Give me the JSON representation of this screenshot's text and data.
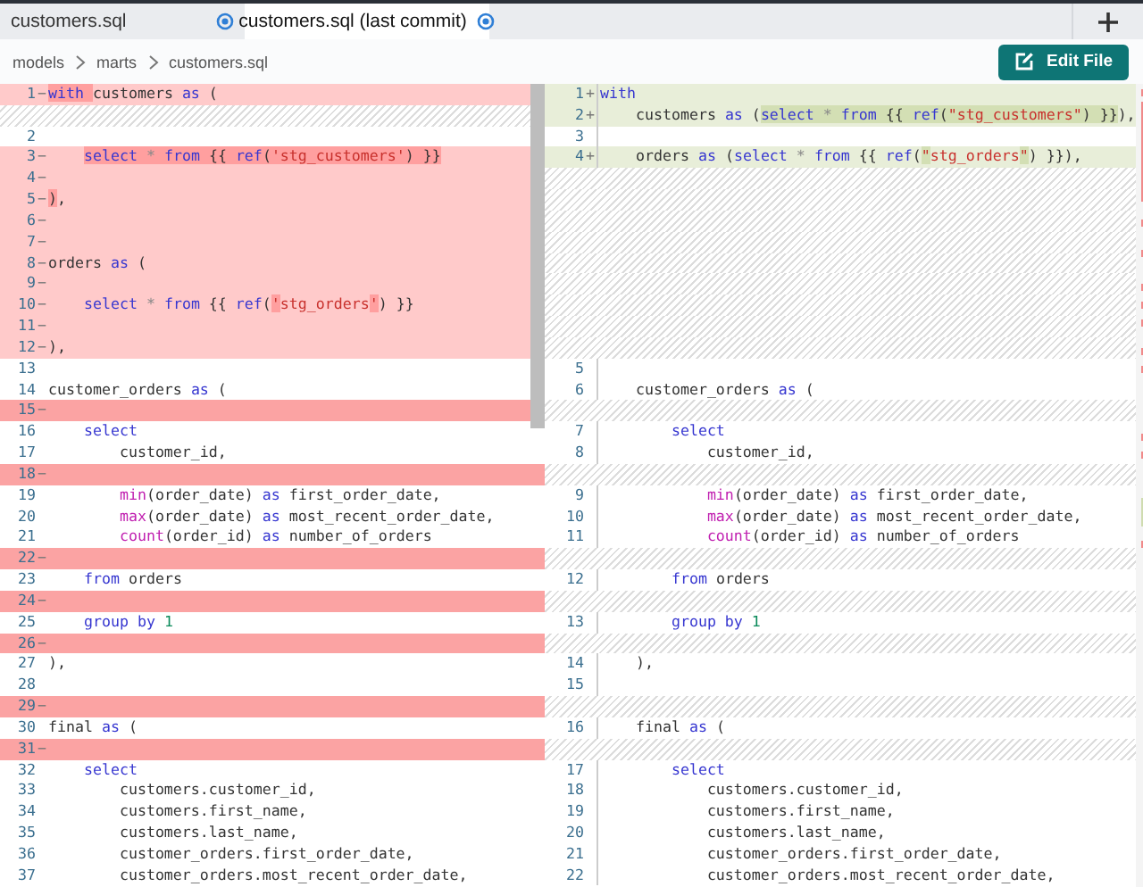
{
  "tabs": [
    {
      "label": "customers.sql",
      "selected": false
    },
    {
      "label": "customers.sql (last commit)",
      "selected": true
    }
  ],
  "breadcrumb": [
    "models",
    "marts",
    "customers.sql"
  ],
  "edit_button": "Edit File",
  "left_lines": [
    {
      "kind": "removed",
      "strong": false,
      "number": "1",
      "sign": "−",
      "code": [
        {
          "kind": "kw",
          "text": "with ",
          "highlighted": true
        },
        {
          "kind": "txt",
          "text": "customers ",
          "highlighted": false
        },
        {
          "kind": "kw",
          "text": "as",
          "highlighted": false
        },
        {
          "kind": "txt",
          "text": " (",
          "highlighted": false
        }
      ]
    },
    {
      "kind": "filler"
    },
    {
      "kind": "context",
      "number": "2"
    },
    {
      "kind": "removed",
      "strong": false,
      "number": "3",
      "sign": "−",
      "code": [
        {
          "kind": "kw",
          "text": "    select",
          "highlighted": true
        },
        {
          "kind": "op",
          "text": " * ",
          "highlighted": true
        },
        {
          "kind": "kw",
          "text": "from",
          "highlighted": true
        },
        {
          "kind": "txt",
          "text": " {{ ",
          "highlighted": true
        },
        {
          "kind": "kw",
          "text": "ref",
          "highlighted": true
        },
        {
          "kind": "txt",
          "text": "(",
          "highlighted": true
        },
        {
          "kind": "str",
          "text": "'stg_customers'",
          "highlighted": true
        },
        {
          "kind": "txt",
          "text": ") }}",
          "highlighted": true
        }
      ]
    },
    {
      "kind": "removed",
      "strong": false,
      "number": "4",
      "sign": "−"
    },
    {
      "kind": "removed",
      "strong": false,
      "number": "5",
      "sign": "−",
      "code": [
        {
          "kind": "txt",
          "text": ")",
          "highlighted": true
        },
        {
          "kind": "txt",
          "text": ",",
          "highlighted": false
        }
      ]
    },
    {
      "kind": "removed",
      "strong": false,
      "number": "6",
      "sign": "−"
    },
    {
      "kind": "removed",
      "strong": false,
      "number": "7",
      "sign": "−"
    },
    {
      "kind": "removed",
      "strong": false,
      "number": "8",
      "sign": "−",
      "code": [
        {
          "kind": "txt",
          "text": "orders ",
          "highlighted": false
        },
        {
          "kind": "kw",
          "text": "as",
          "highlighted": false
        },
        {
          "kind": "txt",
          "text": " (",
          "highlighted": false
        }
      ]
    },
    {
      "kind": "removed",
      "strong": false,
      "number": "9",
      "sign": "−"
    },
    {
      "kind": "removed",
      "strong": false,
      "number": "10",
      "sign": "−",
      "code": [
        {
          "kind": "kw",
          "text": "    select",
          "highlighted": false
        },
        {
          "kind": "op",
          "text": " * ",
          "highlighted": false
        },
        {
          "kind": "kw",
          "text": "from",
          "highlighted": false
        },
        {
          "kind": "txt",
          "text": " {{ ",
          "highlighted": false
        },
        {
          "kind": "kw",
          "text": "ref",
          "highlighted": false
        },
        {
          "kind": "txt",
          "text": "(",
          "highlighted": false
        },
        {
          "kind": "str",
          "text": "'",
          "highlighted": true
        },
        {
          "kind": "str",
          "text": "stg_orders",
          "highlighted": false
        },
        {
          "kind": "str",
          "text": "'",
          "highlighted": true
        },
        {
          "kind": "txt",
          "text": ") }}",
          "highlighted": false
        }
      ]
    },
    {
      "kind": "removed",
      "strong": false,
      "number": "11",
      "sign": "−"
    },
    {
      "kind": "removed",
      "strong": false,
      "number": "12",
      "sign": "−",
      "code": [
        {
          "kind": "txt",
          "text": "),",
          "highlighted": false
        }
      ]
    },
    {
      "kind": "context",
      "number": "13"
    },
    {
      "kind": "context",
      "number": "14",
      "code": [
        {
          "kind": "txt",
          "text": "customer_orders ",
          "highlighted": false
        },
        {
          "kind": "kw",
          "text": "as",
          "highlighted": false
        },
        {
          "kind": "txt",
          "text": " (",
          "highlighted": false
        }
      ]
    },
    {
      "kind": "removed",
      "strong": true,
      "number": "15",
      "sign": "−"
    },
    {
      "kind": "context",
      "number": "16",
      "code": [
        {
          "kind": "kw",
          "text": "    select",
          "highlighted": false
        }
      ]
    },
    {
      "kind": "context",
      "number": "17",
      "code": [
        {
          "kind": "txt",
          "text": "        customer_id,",
          "highlighted": false
        }
      ]
    },
    {
      "kind": "removed",
      "strong": true,
      "number": "18",
      "sign": "−"
    },
    {
      "kind": "context",
      "number": "19",
      "code": [
        {
          "kind": "fn",
          "text": "        min",
          "highlighted": false
        },
        {
          "kind": "txt",
          "text": "(order_date) ",
          "highlighted": false
        },
        {
          "kind": "kw",
          "text": "as",
          "highlighted": false
        },
        {
          "kind": "txt",
          "text": " first_order_date,",
          "highlighted": false
        }
      ]
    },
    {
      "kind": "context",
      "number": "20",
      "code": [
        {
          "kind": "fn",
          "text": "        max",
          "highlighted": false
        },
        {
          "kind": "txt",
          "text": "(order_date) ",
          "highlighted": false
        },
        {
          "kind": "kw",
          "text": "as",
          "highlighted": false
        },
        {
          "kind": "txt",
          "text": " most_recent_order_date,",
          "highlighted": false
        }
      ]
    },
    {
      "kind": "context",
      "number": "21",
      "code": [
        {
          "kind": "fn",
          "text": "        count",
          "highlighted": false
        },
        {
          "kind": "txt",
          "text": "(order_id) ",
          "highlighted": false
        },
        {
          "kind": "kw",
          "text": "as",
          "highlighted": false
        },
        {
          "kind": "txt",
          "text": " number_of_orders",
          "highlighted": false
        }
      ]
    },
    {
      "kind": "removed",
      "strong": true,
      "number": "22",
      "sign": "−"
    },
    {
      "kind": "context",
      "number": "23",
      "code": [
        {
          "kind": "kw",
          "text": "    from",
          "highlighted": false
        },
        {
          "kind": "txt",
          "text": " orders",
          "highlighted": false
        }
      ]
    },
    {
      "kind": "removed",
      "strong": true,
      "number": "24",
      "sign": "−"
    },
    {
      "kind": "context",
      "number": "25",
      "code": [
        {
          "kind": "kw",
          "text": "    group by",
          "highlighted": false
        },
        {
          "kind": "num",
          "text": " 1",
          "highlighted": false
        }
      ]
    },
    {
      "kind": "removed",
      "strong": true,
      "number": "26",
      "sign": "−"
    },
    {
      "kind": "context",
      "number": "27",
      "code": [
        {
          "kind": "txt",
          "text": "),",
          "highlighted": false
        }
      ]
    },
    {
      "kind": "context",
      "number": "28"
    },
    {
      "kind": "removed",
      "strong": true,
      "number": "29",
      "sign": "−"
    },
    {
      "kind": "context",
      "number": "30",
      "code": [
        {
          "kind": "txt",
          "text": "final ",
          "highlighted": false
        },
        {
          "kind": "kw",
          "text": "as",
          "highlighted": false
        },
        {
          "kind": "txt",
          "text": " (",
          "highlighted": false
        }
      ]
    },
    {
      "kind": "removed",
      "strong": true,
      "number": "31",
      "sign": "−"
    },
    {
      "kind": "context",
      "number": "32",
      "code": [
        {
          "kind": "kw",
          "text": "    select",
          "highlighted": false
        }
      ]
    },
    {
      "kind": "context",
      "number": "33",
      "code": [
        {
          "kind": "txt",
          "text": "        customers.customer_id,",
          "highlighted": false
        }
      ]
    },
    {
      "kind": "context",
      "number": "34",
      "code": [
        {
          "kind": "txt",
          "text": "        customers.first_name,",
          "highlighted": false
        }
      ]
    },
    {
      "kind": "context",
      "number": "35",
      "code": [
        {
          "kind": "txt",
          "text": "        customers.last_name,",
          "highlighted": false
        }
      ]
    },
    {
      "kind": "context",
      "number": "36",
      "code": [
        {
          "kind": "txt",
          "text": "        customer_orders.first_order_date,",
          "highlighted": false
        }
      ]
    },
    {
      "kind": "context",
      "number": "37",
      "code": [
        {
          "kind": "txt",
          "text": "        customer_orders.most_recent_order_date,",
          "highlighted": false
        }
      ]
    }
  ],
  "right_lines": [
    {
      "kind": "added",
      "number": "1",
      "sign": "+",
      "code": [
        {
          "kind": "kw",
          "text": "with",
          "highlighted": false
        }
      ]
    },
    {
      "kind": "added",
      "number": "2",
      "sign": "+",
      "code": [
        {
          "kind": "txt",
          "text": "    customers ",
          "highlighted": false
        },
        {
          "kind": "kw",
          "text": "as",
          "highlighted": false
        },
        {
          "kind": "txt",
          "text": " (",
          "highlighted": false
        },
        {
          "kind": "kw",
          "text": "select",
          "highlighted": true
        },
        {
          "kind": "op",
          "text": " * ",
          "highlighted": true
        },
        {
          "kind": "kw",
          "text": "from",
          "highlighted": true
        },
        {
          "kind": "txt",
          "text": " {{ ",
          "highlighted": true
        },
        {
          "kind": "kw",
          "text": "ref",
          "highlighted": true
        },
        {
          "kind": "txt",
          "text": "(",
          "highlighted": true
        },
        {
          "kind": "str",
          "text": "\"stg_customers\"",
          "highlighted": true
        },
        {
          "kind": "txt",
          "text": ") }}",
          "highlighted": true
        },
        {
          "kind": "txt",
          "text": "),",
          "highlighted": false
        }
      ]
    },
    {
      "kind": "context",
      "number": "3"
    },
    {
      "kind": "added",
      "number": "4",
      "sign": "+",
      "code": [
        {
          "kind": "txt",
          "text": "    orders ",
          "highlighted": false
        },
        {
          "kind": "kw",
          "text": "as",
          "highlighted": false
        },
        {
          "kind": "txt",
          "text": " (",
          "highlighted": false
        },
        {
          "kind": "kw",
          "text": "select",
          "highlighted": false
        },
        {
          "kind": "op",
          "text": " * ",
          "highlighted": false
        },
        {
          "kind": "kw",
          "text": "from",
          "highlighted": false
        },
        {
          "kind": "txt",
          "text": " {{ ",
          "highlighted": false
        },
        {
          "kind": "kw",
          "text": "ref",
          "highlighted": false
        },
        {
          "kind": "txt",
          "text": "(",
          "highlighted": false
        },
        {
          "kind": "str",
          "text": "\"",
          "highlighted": true
        },
        {
          "kind": "str",
          "text": "stg_orders",
          "highlighted": false
        },
        {
          "kind": "str",
          "text": "\"",
          "highlighted": true
        },
        {
          "kind": "txt",
          "text": ") }}),",
          "highlighted": false
        }
      ]
    },
    {
      "kind": "filler"
    },
    {
      "kind": "filler"
    },
    {
      "kind": "filler"
    },
    {
      "kind": "filler"
    },
    {
      "kind": "filler"
    },
    {
      "kind": "filler"
    },
    {
      "kind": "filler"
    },
    {
      "kind": "filler"
    },
    {
      "kind": "filler"
    },
    {
      "kind": "context",
      "number": "5"
    },
    {
      "kind": "context",
      "number": "6",
      "code": [
        {
          "kind": "txt",
          "text": "    customer_orders ",
          "highlighted": false
        },
        {
          "kind": "kw",
          "text": "as",
          "highlighted": false
        },
        {
          "kind": "txt",
          "text": " (",
          "highlighted": false
        }
      ]
    },
    {
      "kind": "filler"
    },
    {
      "kind": "context",
      "number": "7",
      "code": [
        {
          "kind": "kw",
          "text": "        select",
          "highlighted": false
        }
      ]
    },
    {
      "kind": "context",
      "number": "8",
      "code": [
        {
          "kind": "txt",
          "text": "            customer_id,",
          "highlighted": false
        }
      ]
    },
    {
      "kind": "filler"
    },
    {
      "kind": "context",
      "number": "9",
      "code": [
        {
          "kind": "fn",
          "text": "            min",
          "highlighted": false
        },
        {
          "kind": "txt",
          "text": "(order_date) ",
          "highlighted": false
        },
        {
          "kind": "kw",
          "text": "as",
          "highlighted": false
        },
        {
          "kind": "txt",
          "text": " first_order_date,",
          "highlighted": false
        }
      ]
    },
    {
      "kind": "context",
      "number": "10",
      "code": [
        {
          "kind": "fn",
          "text": "            max",
          "highlighted": false
        },
        {
          "kind": "txt",
          "text": "(order_date) ",
          "highlighted": false
        },
        {
          "kind": "kw",
          "text": "as",
          "highlighted": false
        },
        {
          "kind": "txt",
          "text": " most_recent_order_date,",
          "highlighted": false
        }
      ]
    },
    {
      "kind": "context",
      "number": "11",
      "code": [
        {
          "kind": "fn",
          "text": "            count",
          "highlighted": false
        },
        {
          "kind": "txt",
          "text": "(order_id) ",
          "highlighted": false
        },
        {
          "kind": "kw",
          "text": "as",
          "highlighted": false
        },
        {
          "kind": "txt",
          "text": " number_of_orders",
          "highlighted": false
        }
      ]
    },
    {
      "kind": "filler"
    },
    {
      "kind": "context",
      "number": "12",
      "code": [
        {
          "kind": "kw",
          "text": "        from",
          "highlighted": false
        },
        {
          "kind": "txt",
          "text": " orders",
          "highlighted": false
        }
      ]
    },
    {
      "kind": "filler"
    },
    {
      "kind": "context",
      "number": "13",
      "code": [
        {
          "kind": "kw",
          "text": "        group by",
          "highlighted": false
        },
        {
          "kind": "num",
          "text": " 1",
          "highlighted": false
        }
      ]
    },
    {
      "kind": "filler"
    },
    {
      "kind": "context",
      "number": "14",
      "code": [
        {
          "kind": "txt",
          "text": "    ),",
          "highlighted": false
        }
      ]
    },
    {
      "kind": "context",
      "number": "15"
    },
    {
      "kind": "filler"
    },
    {
      "kind": "context",
      "number": "16",
      "code": [
        {
          "kind": "txt",
          "text": "    final ",
          "highlighted": false
        },
        {
          "kind": "kw",
          "text": "as",
          "highlighted": false
        },
        {
          "kind": "txt",
          "text": " (",
          "highlighted": false
        }
      ]
    },
    {
      "kind": "filler"
    },
    {
      "kind": "context",
      "number": "17",
      "code": [
        {
          "kind": "kw",
          "text": "        select",
          "highlighted": false
        }
      ]
    },
    {
      "kind": "context",
      "number": "18",
      "code": [
        {
          "kind": "txt",
          "text": "            customers.customer_id,",
          "highlighted": false
        }
      ]
    },
    {
      "kind": "context",
      "number": "19",
      "code": [
        {
          "kind": "txt",
          "text": "            customers.first_name,",
          "highlighted": false
        }
      ]
    },
    {
      "kind": "context",
      "number": "20",
      "code": [
        {
          "kind": "txt",
          "text": "            customers.last_name,",
          "highlighted": false
        }
      ]
    },
    {
      "kind": "context",
      "number": "21",
      "code": [
        {
          "kind": "txt",
          "text": "            customer_orders.first_order_date,",
          "highlighted": false
        }
      ]
    },
    {
      "kind": "context",
      "number": "22",
      "code": [
        {
          "kind": "txt",
          "text": "            customer_orders.most_recent_order_date,",
          "highlighted": false
        }
      ]
    }
  ]
}
